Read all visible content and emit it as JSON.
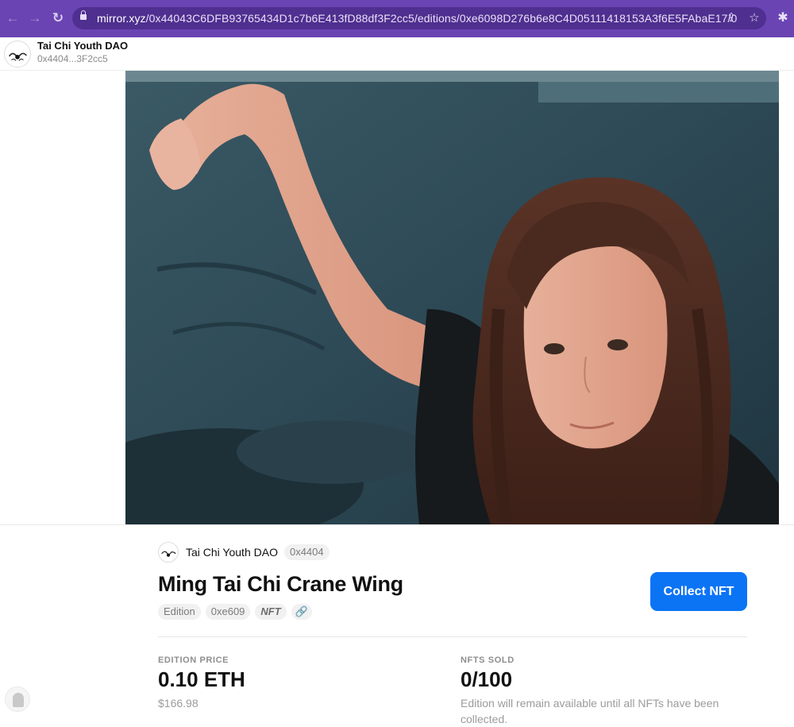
{
  "browser": {
    "url_host": "mirror.xyz",
    "url_path": "/0x44043C6DFB93765434D1c7b6E413fD88df3F2cc5/editions/0xe6098D276b6e8C4D05111418153A3f6E5FAbaE17/0",
    "icons": [
      "back-arrow-icon",
      "forward-arrow-icon",
      "reload-icon",
      "lock-icon",
      "share-icon",
      "bookmark-star-icon",
      "extensions-puzzle-icon"
    ],
    "accent": "#6a44b3"
  },
  "header": {
    "publication_name": "Tai Chi Youth DAO",
    "publication_address": "0x4404...3F2cc5"
  },
  "edition": {
    "creator_name": "Tai Chi Youth DAO",
    "creator_address": "0x4404",
    "title": "Ming Tai Chi Crane Wing",
    "tags": {
      "edition": "Edition",
      "contract": "0xe609",
      "nft": "NFT"
    },
    "collect_label": "Collect NFT",
    "collect_color": "#0b74f5"
  },
  "stats": {
    "price_label": "EDITION PRICE",
    "price_value": "0.10 ETH",
    "price_usd": "$166.98",
    "sold_label": "NFTS SOLD",
    "sold_value": "0/100",
    "sold_note": "Edition will remain available until all NFTs have been collected."
  }
}
